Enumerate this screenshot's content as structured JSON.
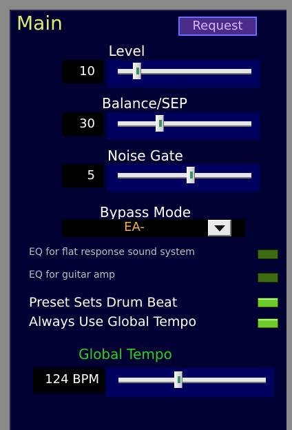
{
  "panel": {
    "title": "Main",
    "request_button": "Request"
  },
  "level": {
    "label": "Level",
    "value": "10",
    "slider_fraction": 0.12
  },
  "balance": {
    "label": "Balance/SEP",
    "value": "30",
    "slider_fraction": 0.3
  },
  "noise_gate": {
    "label": "Noise Gate",
    "value": "5",
    "slider_fraction": 0.55
  },
  "bypass": {
    "label": "Bypass Mode",
    "value": "EA-"
  },
  "toggles": {
    "eq_flat": {
      "label": "EQ for flat response sound system",
      "on": false
    },
    "eq_guitar": {
      "label": "EQ for guitar amp",
      "on": false
    },
    "preset_drum": {
      "label": "Preset Sets Drum Beat",
      "on": true
    },
    "global_tempo_toggle": {
      "label": "Always Use Global Tempo",
      "on": true
    }
  },
  "global_tempo": {
    "title": "Global Tempo",
    "value": "124 BPM",
    "slider_fraction": 0.4
  },
  "colors": {
    "panel_bg": "#000033",
    "title": "#dfee6a",
    "tempo_title": "#26d41e",
    "dropdown_value": "#f3b24a",
    "led_on": "#6ecb2b",
    "led_off": "#3c6b12"
  }
}
